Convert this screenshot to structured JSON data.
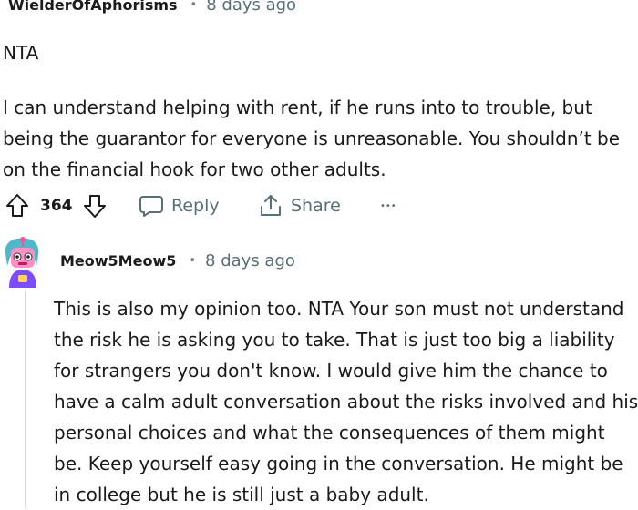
{
  "parent_comment": {
    "author": "WielderOfAphorisms",
    "separator": "•",
    "time": "8 days ago",
    "paragraphs": [
      [
        "NTA"
      ],
      [
        "I can understand helping with rent, if he runs into to trouble, but",
        "being the guarantor for everyone is unreasonable. You shouldn’t be",
        "on the financial hook for two other adults."
      ]
    ],
    "actions": {
      "upvote_icon": "arrow-up-outline-icon",
      "vote_count": "364",
      "downvote_icon": "arrow-down-outline-icon",
      "reply_label": "Reply",
      "reply_icon": "speech-bubble-icon",
      "share_label": "Share",
      "share_icon": "share-arrow-icon",
      "more_label": "•••",
      "more_icon": "more-options-icon"
    }
  },
  "reply_comment": {
    "author": "Meow5Meow5",
    "separator": "•",
    "time": "8 days ago",
    "avatar_icon": "robot-avatar-icon",
    "lines": [
      "This is also my opinion too. NTA Your son must not understand",
      "the risk he is asking you to take. That is just too big a liability",
      "for strangers you don't know. I would give him the chance to",
      "have a calm adult conversation about the risks involved and his",
      "personal choices and what the consequences of them might",
      "be. Keep yourself easy going in the conversation. He might be",
      "in college but he is still just a baby adult."
    ]
  },
  "colors": {
    "text": "#1a1a1b",
    "meta": "#576f76",
    "thread_line": "#d9dee0",
    "avatar_teal": "#4fb7c8",
    "avatar_pink": "#ff4fa3"
  }
}
